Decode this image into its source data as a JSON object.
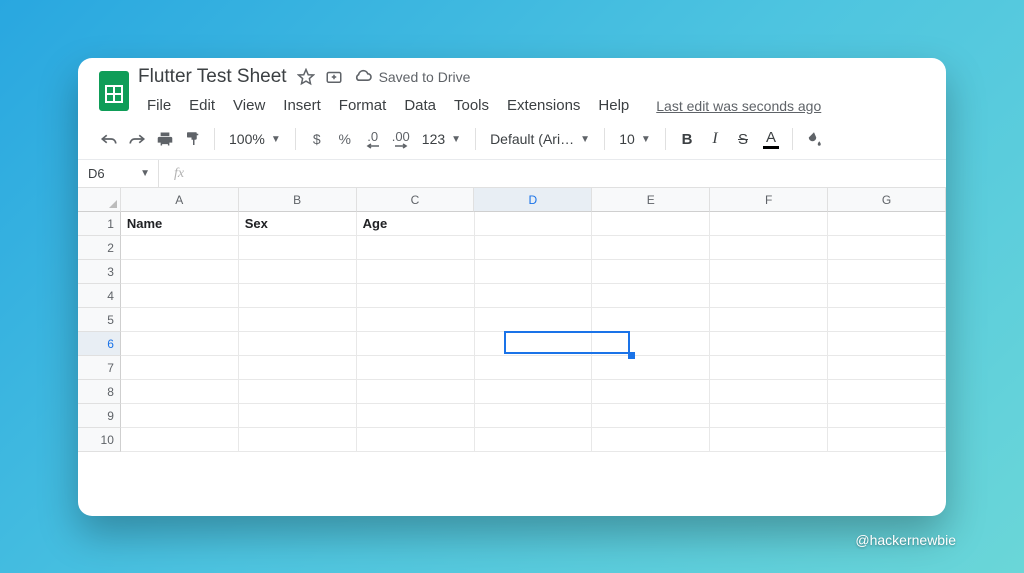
{
  "doc": {
    "title": "Flutter Test Sheet",
    "saved_label": "Saved to Drive",
    "last_edit": "Last edit was seconds ago"
  },
  "menus": [
    "File",
    "Edit",
    "View",
    "Insert",
    "Format",
    "Data",
    "Tools",
    "Extensions",
    "Help"
  ],
  "toolbar": {
    "zoom": "100%",
    "currency": "$",
    "percent": "%",
    "dec_decrease": ".0",
    "dec_increase": ".00",
    "numfmt": "123",
    "font": "Default (Ari…",
    "font_size": "10"
  },
  "namebox": {
    "ref": "D6",
    "fx": "fx",
    "formula": ""
  },
  "grid": {
    "columns": [
      "A",
      "B",
      "C",
      "D",
      "E",
      "F",
      "G"
    ],
    "row_count": 10,
    "selected": {
      "col": "D",
      "row": 6,
      "col_index": 3,
      "row_index": 5
    },
    "cells": {
      "r1": {
        "A": "Name",
        "B": "Sex",
        "C": "Age"
      }
    }
  },
  "chart_data": {
    "type": "table",
    "columns": [
      "Name",
      "Sex",
      "Age"
    ],
    "rows": []
  },
  "watermark": "@hackernewbie"
}
